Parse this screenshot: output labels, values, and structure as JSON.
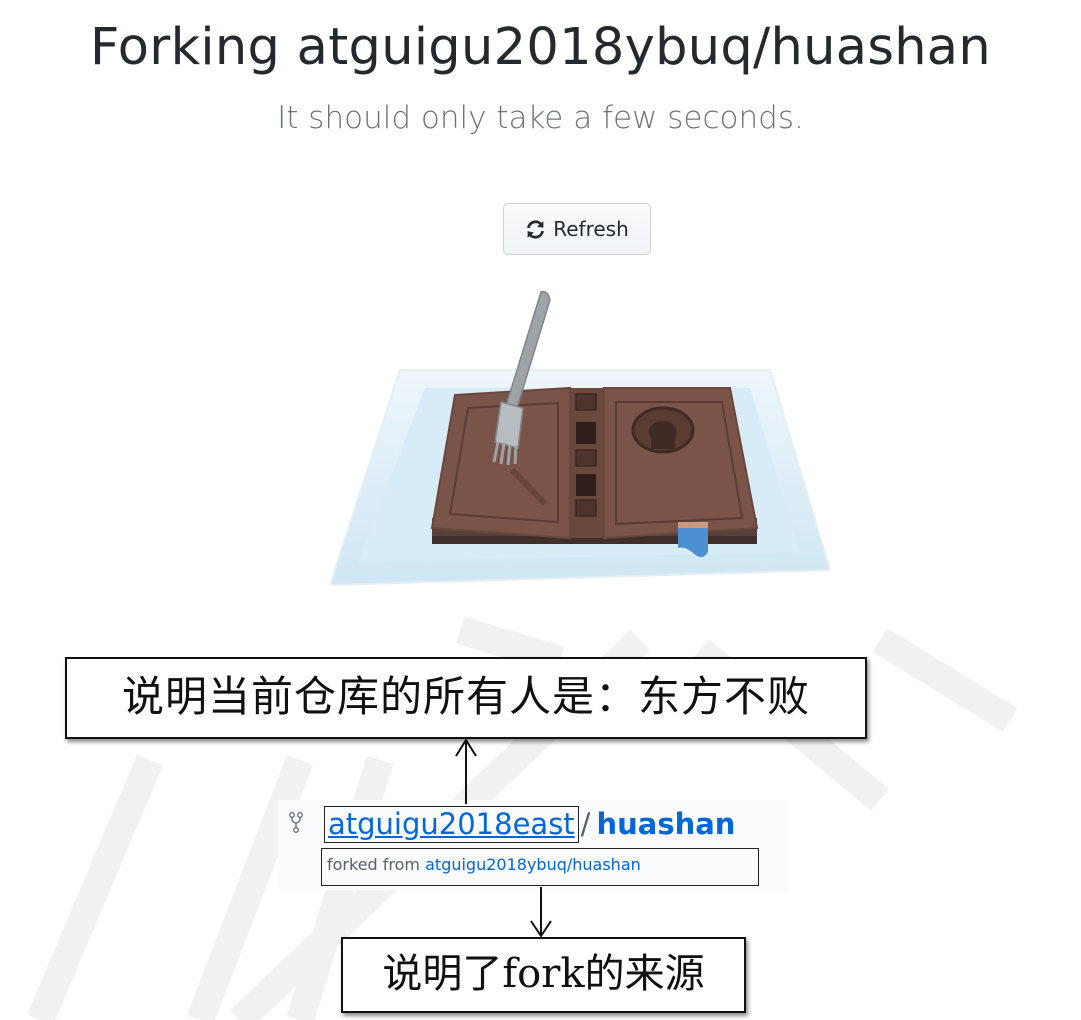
{
  "page": {
    "title": "Forking atguigu2018ybuq/huashan",
    "subtitle": "It should only take a few seconds.",
    "refresh_label": "Refresh"
  },
  "repo": {
    "owner": "atguigu2018east",
    "separator": "/",
    "name": "huashan",
    "forked_from_label": "forked from",
    "forked_from_link": "atguigu2018ybuq/huashan"
  },
  "annotations": {
    "owner_note": "说明当前仓库的所有人是：东方不败",
    "source_note": "说明了fork的来源"
  },
  "colors": {
    "link": "#0366d6",
    "title": "#24292e",
    "muted": "#6a737d"
  },
  "icons": {
    "refresh": "sync-icon",
    "fork": "repo-forked-icon"
  }
}
